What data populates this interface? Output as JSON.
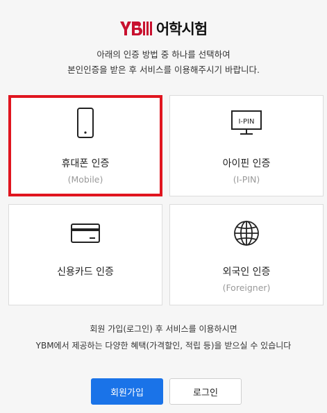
{
  "header": {
    "logo_mark": "YBM",
    "logo_text": "어학시험",
    "brand_color": "#c8102e"
  },
  "intro": {
    "line1": "아래의 인증 방법 중 하나를 선택하여",
    "line2": "본인인증을 받은 후 서비스를 이용해주시기 바랍니다."
  },
  "methods": [
    {
      "title": "휴대폰 인증",
      "subtitle": "(Mobile)",
      "icon": "mobile-phone-icon",
      "selected": true
    },
    {
      "title": "아이핀 인증",
      "subtitle": "(I-PIN)",
      "icon": "ipin-monitor-icon",
      "icon_label": "I-PIN",
      "selected": false
    },
    {
      "title": "신용카드 인증",
      "subtitle": "",
      "icon": "credit-card-icon",
      "selected": false
    },
    {
      "title": "외국인 인증",
      "subtitle": "(Foreigner)",
      "icon": "globe-icon",
      "selected": false
    }
  ],
  "notice": {
    "line1": "회원 가입(로그인) 후 서비스를 이용하시면",
    "line2": "YBM에서 제공하는 다양한 혜택(가격할인, 적립 등)을 받으실 수 있습니다"
  },
  "buttons": {
    "signup": "회원가입",
    "login": "로그인"
  },
  "colors": {
    "selected_border": "#e0151f",
    "primary_button": "#1a73e8"
  }
}
